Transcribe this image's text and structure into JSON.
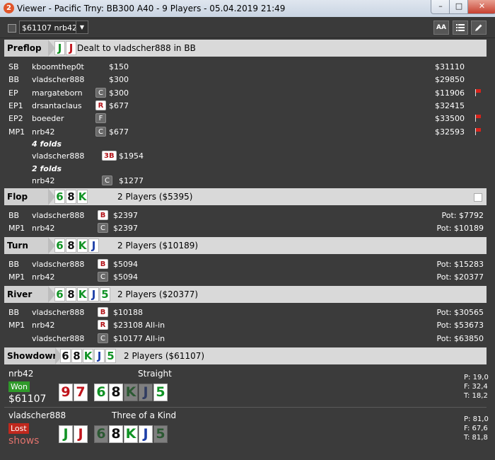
{
  "window": {
    "title": "Viewer - Pacific Trny: BB300 A40 - 9 Players - 05.04.2019 21:49",
    "app_icon": "2",
    "minimize": "–",
    "maximize": "□",
    "close": "✕"
  },
  "toolbar": {
    "hand_select_value": "$61107 nrb42",
    "font_button": "AA",
    "list_icon": "list-icon",
    "edit_icon": "pencil-icon"
  },
  "preflop": {
    "label": "Preflop",
    "cards": [
      {
        "rank": "J",
        "color": "green"
      },
      {
        "rank": "J",
        "color": "red"
      }
    ],
    "info": "Dealt to vladscher888 in BB",
    "rows": [
      {
        "pos": "SB",
        "name": "kboomthep0t",
        "action": "",
        "amount": "$150",
        "stack": "$31110",
        "flag": false
      },
      {
        "pos": "BB",
        "name": "vladscher888",
        "action": "",
        "amount": "$300",
        "stack": "$29850",
        "flag": false
      },
      {
        "pos": "EP",
        "name": "margateborn",
        "action": "C",
        "amount": "$300",
        "stack": "$11906",
        "flag": true
      },
      {
        "pos": "EP1",
        "name": "drsantaclaus",
        "action": "R",
        "amount": "$677",
        "stack": "$32415",
        "flag": false
      },
      {
        "pos": "EP2",
        "name": "boeeder",
        "action": "F",
        "amount": "",
        "stack": "$33500",
        "flag": true
      },
      {
        "pos": "MP1",
        "name": "nrb42",
        "action": "C",
        "amount": "$677",
        "stack": "$32593",
        "flag": true
      }
    ],
    "folds1": "4 folds",
    "raise_row": {
      "name": "vladscher888",
      "action": "3B",
      "amount": "$1954"
    },
    "folds2": "2 folds",
    "call_row": {
      "name": "nrb42",
      "action": "C",
      "amount": "$1277"
    }
  },
  "flop": {
    "label": "Flop",
    "cards": [
      {
        "rank": "6",
        "color": "green"
      },
      {
        "rank": "8",
        "color": "black"
      },
      {
        "rank": "K",
        "color": "green"
      }
    ],
    "info": "2 Players ($5395)",
    "rows": [
      {
        "pos": "BB",
        "name": "vladscher888",
        "action": "B",
        "amount": "$2397",
        "pot": "Pot: $7792"
      },
      {
        "pos": "MP1",
        "name": "nrb42",
        "action": "C",
        "amount": "$2397",
        "pot": "Pot: $10189"
      }
    ]
  },
  "turn": {
    "label": "Turn",
    "cards": [
      {
        "rank": "6",
        "color": "green"
      },
      {
        "rank": "8",
        "color": "black"
      },
      {
        "rank": "K",
        "color": "green"
      },
      {
        "rank": "J",
        "color": "blue"
      }
    ],
    "info": "2 Players ($10189)",
    "rows": [
      {
        "pos": "BB",
        "name": "vladscher888",
        "action": "B",
        "amount": "$5094",
        "pot": "Pot: $15283"
      },
      {
        "pos": "MP1",
        "name": "nrb42",
        "action": "C",
        "amount": "$5094",
        "pot": "Pot: $20377"
      }
    ]
  },
  "river": {
    "label": "River",
    "cards": [
      {
        "rank": "6",
        "color": "green"
      },
      {
        "rank": "8",
        "color": "black"
      },
      {
        "rank": "K",
        "color": "green"
      },
      {
        "rank": "J",
        "color": "blue"
      },
      {
        "rank": "5",
        "color": "green"
      }
    ],
    "info": "2 Players ($20377)",
    "rows": [
      {
        "pos": "BB",
        "name": "vladscher888",
        "action": "B",
        "amount": "$10188",
        "pot": "Pot: $30565"
      },
      {
        "pos": "MP1",
        "name": "nrb42",
        "action": "R",
        "amount": "$23108 All-in",
        "pot": "Pot: $53673"
      },
      {
        "pos": "",
        "name": "vladscher888",
        "action": "C",
        "amount": "$10177 All-in",
        "pot": "Pot: $63850"
      }
    ]
  },
  "showdown": {
    "label": "Showdown",
    "cards": [
      {
        "rank": "6",
        "color": "black"
      },
      {
        "rank": "8",
        "color": "black"
      },
      {
        "rank": "K",
        "color": "green"
      },
      {
        "rank": "J",
        "color": "blue"
      },
      {
        "rank": "5",
        "color": "green"
      }
    ],
    "info": "2 Players ($61107)",
    "players": [
      {
        "name": "nrb42",
        "hand": "Straight",
        "result": "Won",
        "amount": "$61107",
        "hole": [
          {
            "rank": "9",
            "color": "red"
          },
          {
            "rank": "7",
            "color": "red"
          }
        ],
        "board": [
          {
            "rank": "6",
            "color": "green",
            "dim": false
          },
          {
            "rank": "8",
            "color": "black",
            "dim": false
          },
          {
            "rank": "K",
            "color": "green",
            "dim": true
          },
          {
            "rank": "J",
            "color": "blue",
            "dim": true
          },
          {
            "rank": "5",
            "color": "green",
            "dim": false
          }
        ],
        "stats": [
          "P: 19,0",
          "F: 32,4",
          "T: 18,2"
        ]
      },
      {
        "name": "vladscher888",
        "hand": "Three of a Kind",
        "result": "Lost",
        "amount": "shows",
        "hole": [
          {
            "rank": "J",
            "color": "green"
          },
          {
            "rank": "J",
            "color": "red"
          }
        ],
        "board": [
          {
            "rank": "6",
            "color": "green",
            "dim": true
          },
          {
            "rank": "8",
            "color": "black",
            "dim": false
          },
          {
            "rank": "K",
            "color": "green",
            "dim": false
          },
          {
            "rank": "J",
            "color": "blue",
            "dim": false
          },
          {
            "rank": "5",
            "color": "green",
            "dim": true
          }
        ],
        "stats": [
          "P: 81,0",
          "F: 67,6",
          "T: 81,8"
        ]
      }
    ]
  },
  "colors": {
    "red": "#c0141c",
    "green": "#129326",
    "blue": "#1d3fa8",
    "black": "#111111"
  }
}
